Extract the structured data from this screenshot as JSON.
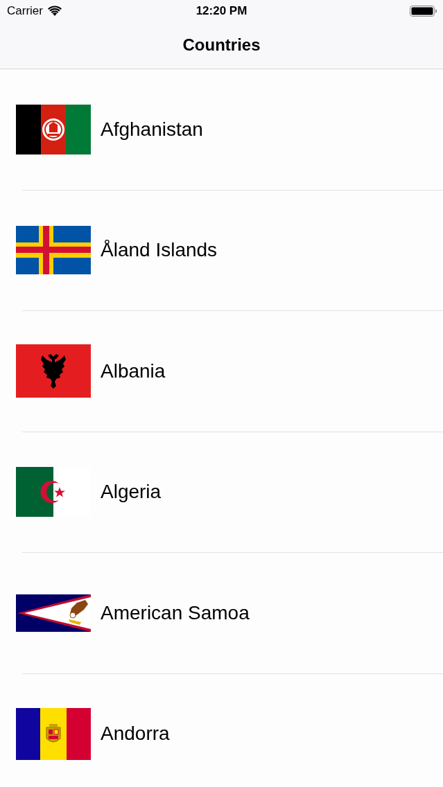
{
  "status_bar": {
    "carrier": "Carrier",
    "time": "12:20 PM"
  },
  "nav_bar": {
    "title": "Countries"
  },
  "countries": [
    {
      "name": "Afghanistan",
      "kind": "afghanistan"
    },
    {
      "name": "Åland Islands",
      "kind": "aland"
    },
    {
      "name": "Albania",
      "kind": "albania"
    },
    {
      "name": "Algeria",
      "kind": "algeria"
    },
    {
      "name": "American Samoa",
      "kind": "samoa"
    },
    {
      "name": "Andorra",
      "kind": "andorra"
    }
  ]
}
